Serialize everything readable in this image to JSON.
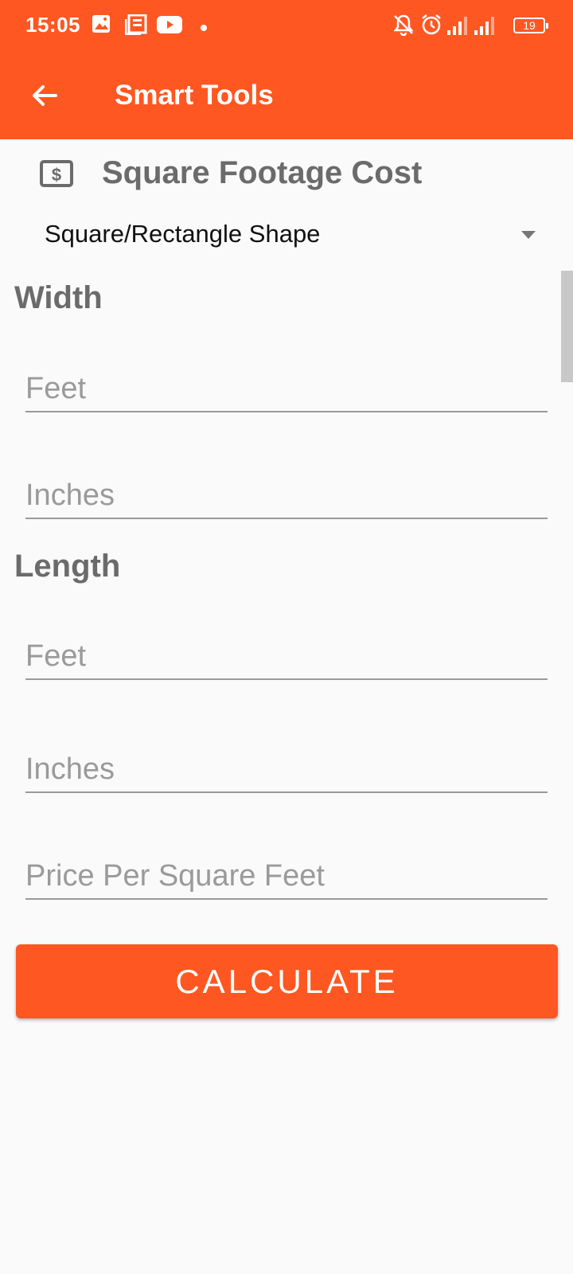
{
  "status_bar": {
    "time": "15:05",
    "battery": "19",
    "icons": [
      "gallery-icon",
      "news-icon",
      "youtube-icon",
      "dot-icon",
      "bell-off-icon",
      "alarm-icon",
      "signal-icon",
      "signal-icon",
      "battery-icon"
    ]
  },
  "app_bar": {
    "title": "Smart Tools",
    "back_icon": "arrow-left-icon",
    "color": "#ff5722"
  },
  "page": {
    "title": "Square Footage Cost",
    "title_icon": "dollar-bill-icon",
    "shape_select": {
      "value": "Square/Rectangle Shape"
    }
  },
  "width_section": {
    "label": "Width",
    "feet_placeholder": "Feet",
    "inches_placeholder": "Inches"
  },
  "length_section": {
    "label": "Length",
    "feet_placeholder": "Feet",
    "inches_placeholder": "Inches"
  },
  "price": {
    "placeholder": "Price Per Square Feet"
  },
  "calculate_button": {
    "label": "CALCULATE"
  }
}
